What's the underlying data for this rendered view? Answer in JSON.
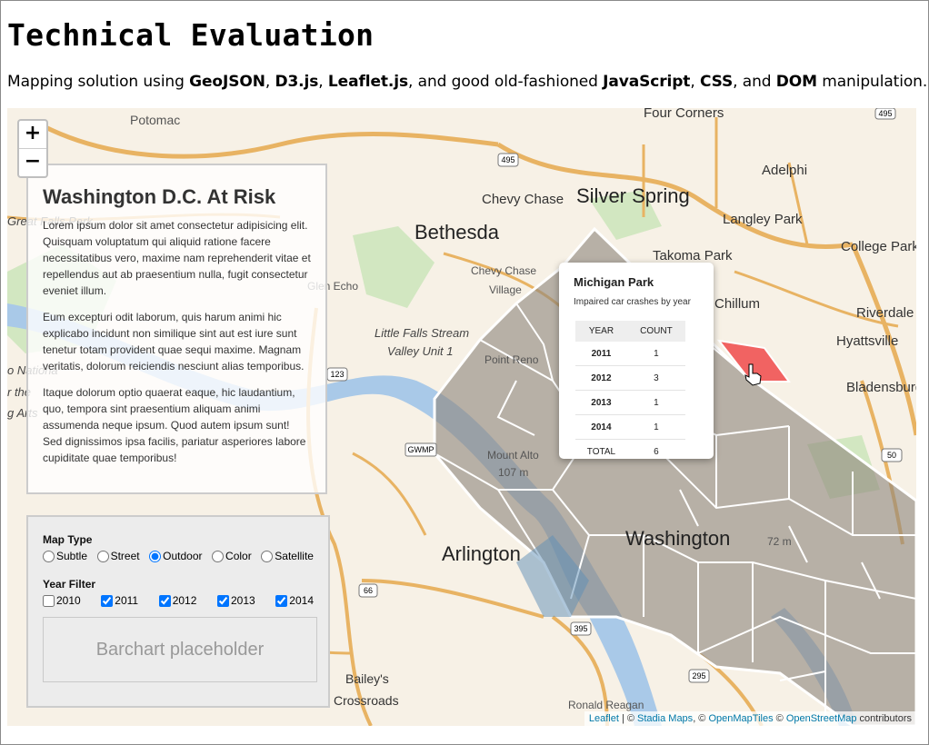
{
  "page": {
    "title": "Technical Evaluation",
    "intro": {
      "p1": "Mapping solution using ",
      "b1": "GeoJSON",
      "p2": ", ",
      "b2": "D3.js",
      "p3": ", ",
      "b3": "Leaflet.js",
      "p4": ", and good old-fashioned ",
      "b4": "JavaScript",
      "p5": ", ",
      "b5": "CSS",
      "p6": ", and ",
      "b6": "DOM",
      "p7": " manipulation."
    }
  },
  "map": {
    "zoom_in": "+",
    "zoom_out": "−",
    "places": {
      "potomac": "Potomac",
      "four_corners": "Four Corners",
      "adelphi": "Adelphi",
      "chevy_chase": "Chevy Chase",
      "silver_spring": "Silver Spring",
      "bethesda": "Bethesda",
      "langley_park": "Langley Park",
      "college_park": "College Park",
      "takoma_park": "Takoma Park",
      "great_falls_park": "Great Falls Park",
      "chevy_chase_village_1": "Chevy Chase",
      "chevy_chase_village_2": "Village",
      "glen_echo": "Glen Echo",
      "chillum": "Chillum",
      "riverdale": "Riverdale",
      "little_falls_1": "Little Falls Stream",
      "little_falls_2": "Valley Unit 1",
      "hyattsville": "Hyattsville",
      "point_reno": "Point Reno",
      "bladensburg": "Bladensburg",
      "national_1": "o Nationa",
      "national_2": "r the",
      "national_3": "g Arts",
      "mount_alto": "Mount Alto",
      "mount_alto_elev": "107 m",
      "arlington": "Arlington",
      "washington": "Washington",
      "baileys_1": "Bailey's",
      "baileys_2": "Crossroads",
      "ronald_reagan": "Ronald Reagan",
      "elev_72": "72 m"
    },
    "shields": {
      "i495a": "495",
      "i495b": "495",
      "r123": "123",
      "gwmp": "GWMP",
      "r50": "50",
      "r66": "66",
      "i395": "395",
      "i295": "295"
    },
    "attribution": {
      "leaflet": "Leaflet",
      "sep1": " | © ",
      "stadia": "Stadia Maps",
      "sep2": ", © ",
      "openmaptiles": "OpenMapTiles",
      "sep3": " © ",
      "osm": "OpenStreetMap",
      "tail": " contributors"
    },
    "colors": {
      "land": "#f7f1e6",
      "water": "#a9c9e8",
      "park": "#d2e7c1",
      "highway": "#e8b363",
      "neighborhood_fill": "#8f877e",
      "highlight": "#f04a4a"
    }
  },
  "info_panel": {
    "title": "Washington D.C. At Risk",
    "paragraphs": [
      "Lorem ipsum dolor sit amet consectetur adipisicing elit. Quisquam voluptatum qui aliquid ratione facere necessitatibus vero, maxime nam reprehenderit vitae et repellendus aut ab praesentium nulla, fugit consectetur eveniet illum.",
      "Eum excepturi odit laborum, quis harum animi hic explicabo incidunt non similique sint aut est iure sunt tenetur totam provident quae sequi maxime. Magnam veritatis, dolorum reiciendis nesciunt alias temporibus.",
      "Itaque dolorum optio quaerat eaque, hic laudantium, quo, tempora sint praesentium aliquam animi assumenda neque ipsum. Quod autem ipsum sunt! Sed dignissimos ipsa facilis, pariatur asperiores labore cupiditate quae temporibus!"
    ]
  },
  "controls": {
    "map_type_label": "Map Type",
    "map_types": [
      {
        "label": "Subtle",
        "checked": false
      },
      {
        "label": "Street",
        "checked": false
      },
      {
        "label": "Outdoor",
        "checked": true
      },
      {
        "label": "Color",
        "checked": false
      },
      {
        "label": "Satellite",
        "checked": false
      }
    ],
    "year_filter_label": "Year Filter",
    "years": [
      {
        "label": "2010",
        "checked": false
      },
      {
        "label": "2011",
        "checked": true
      },
      {
        "label": "2012",
        "checked": true
      },
      {
        "label": "2013",
        "checked": true
      },
      {
        "label": "2014",
        "checked": true
      }
    ],
    "barchart_placeholder": "Barchart placeholder"
  },
  "popup": {
    "title": "Michigan Park",
    "subtitle": "Impaired car crashes by year",
    "headers": [
      "YEAR",
      "COUNT"
    ],
    "rows": [
      {
        "year": "2011",
        "count": "1"
      },
      {
        "year": "2012",
        "count": "3"
      },
      {
        "year": "2013",
        "count": "1"
      },
      {
        "year": "2014",
        "count": "1"
      }
    ],
    "total_label": "TOTAL",
    "total_value": "6"
  }
}
